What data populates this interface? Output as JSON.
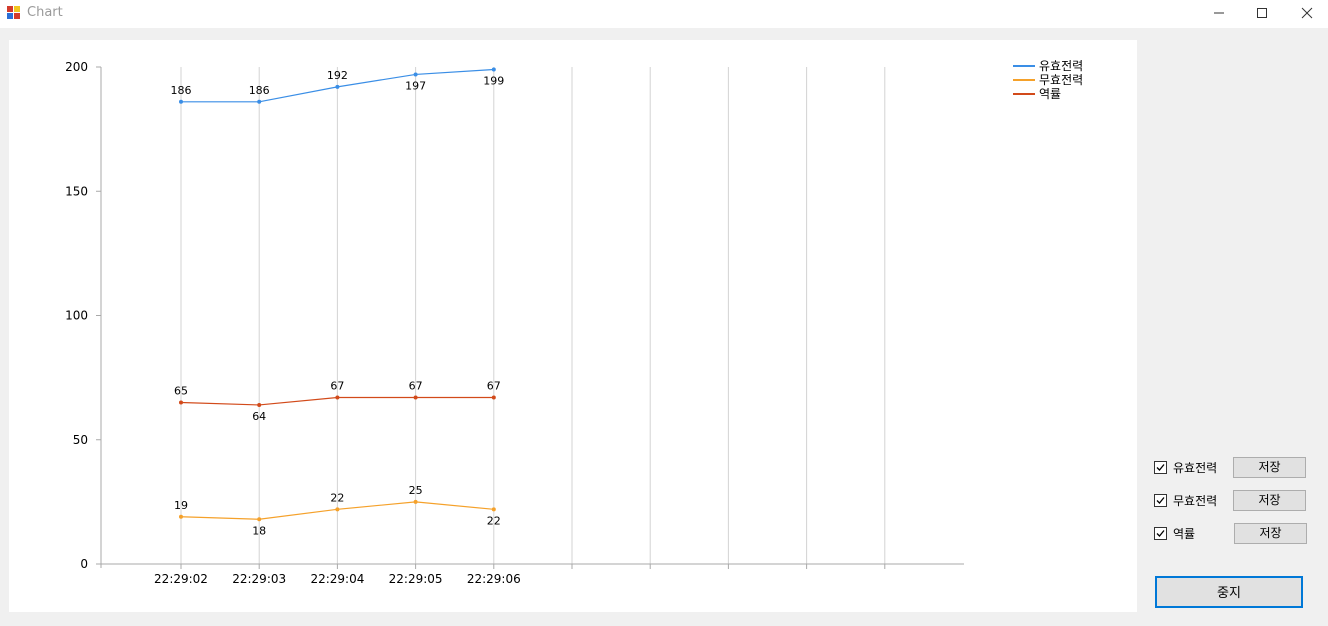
{
  "window": {
    "title": "Chart",
    "controls": [
      "minimize-icon",
      "maximize-icon",
      "close-icon"
    ]
  },
  "chart_data": {
    "type": "line",
    "x": [
      "22:29:02",
      "22:29:03",
      "22:29:04",
      "22:29:05",
      "22:29:06"
    ],
    "ylim": [
      0,
      200
    ],
    "yticks": [
      "0",
      "50",
      "100",
      "150",
      "200"
    ],
    "grid": "vertical",
    "legend_position": "top-right",
    "series": [
      {
        "name": "유효전력",
        "color": "#3a8ee6",
        "values": [
          186,
          186,
          192,
          197,
          199
        ],
        "label_pos": [
          "above",
          "above",
          "above",
          "below",
          "below"
        ]
      },
      {
        "name": "무효전력",
        "color": "#f5a12a",
        "values": [
          19,
          18,
          22,
          25,
          22
        ],
        "label_pos": [
          "above",
          "below",
          "above",
          "above",
          "below"
        ]
      },
      {
        "name": "역률",
        "color": "#d24a1a",
        "values": [
          65,
          64,
          67,
          67,
          67
        ],
        "label_pos": [
          "above",
          "below",
          "above",
          "above",
          "above"
        ]
      }
    ]
  },
  "controls": {
    "rows": [
      {
        "label": "유효전력",
        "checked": true,
        "save_label": "저장"
      },
      {
        "label": "무효전력",
        "checked": true,
        "save_label": "저장"
      },
      {
        "label": "역률",
        "checked": true,
        "save_label": "저장"
      }
    ],
    "stop_label": "중지"
  }
}
